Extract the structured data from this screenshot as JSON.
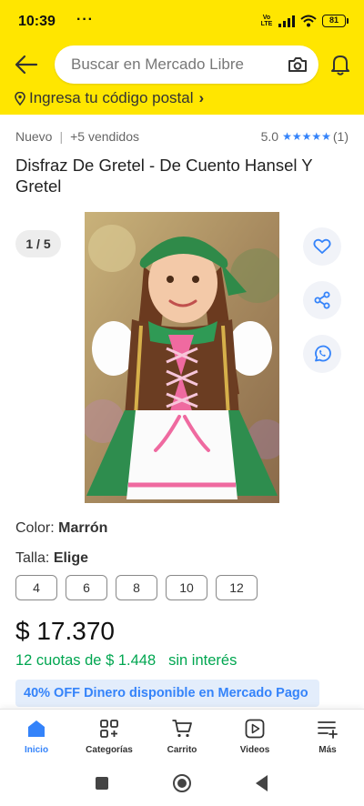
{
  "status_bar": {
    "time": "10:39",
    "dots": "···",
    "volte": "Vo LTE",
    "battery": "81"
  },
  "header": {
    "search_placeholder": "Buscar en Mercado Libre",
    "postal_text": "Ingresa tu código postal",
    "postal_chevron": "›",
    "background_color": "#ffe600"
  },
  "product": {
    "condition": "Nuevo",
    "separator": "|",
    "sold": "+5 vendidos",
    "rating": "5.0",
    "stars": "★★★★★",
    "reviews": "(1)",
    "title": "Disfraz De Gretel - De Cuento Hansel Y Gretel",
    "image_counter": "1 / 5",
    "color_label": "Color:",
    "color_value": "Marrón",
    "size_label": "Talla:",
    "size_value": "Elige",
    "sizes": [
      "4",
      "6",
      "8",
      "10",
      "12"
    ],
    "price": "$ 17.370",
    "installments": "12 cuotas de $ 1.448",
    "interest": "sin interés",
    "promo": "40% OFF Dinero disponible en Mercado Pago"
  },
  "colors": {
    "accent": "#3483fa",
    "green": "#00a650",
    "yellow": "#ffe600"
  },
  "icons": [
    "back-arrow-icon",
    "camera-icon",
    "bell-icon",
    "location-pin-icon",
    "heart-icon",
    "share-icon",
    "whatsapp-icon",
    "home-icon",
    "categories-icon",
    "cart-icon",
    "video-icon",
    "more-icon"
  ],
  "nav": {
    "items": [
      {
        "label": "Inicio"
      },
      {
        "label": "Categorías"
      },
      {
        "label": "Carrito"
      },
      {
        "label": "Videos"
      },
      {
        "label": "Más"
      }
    ]
  }
}
